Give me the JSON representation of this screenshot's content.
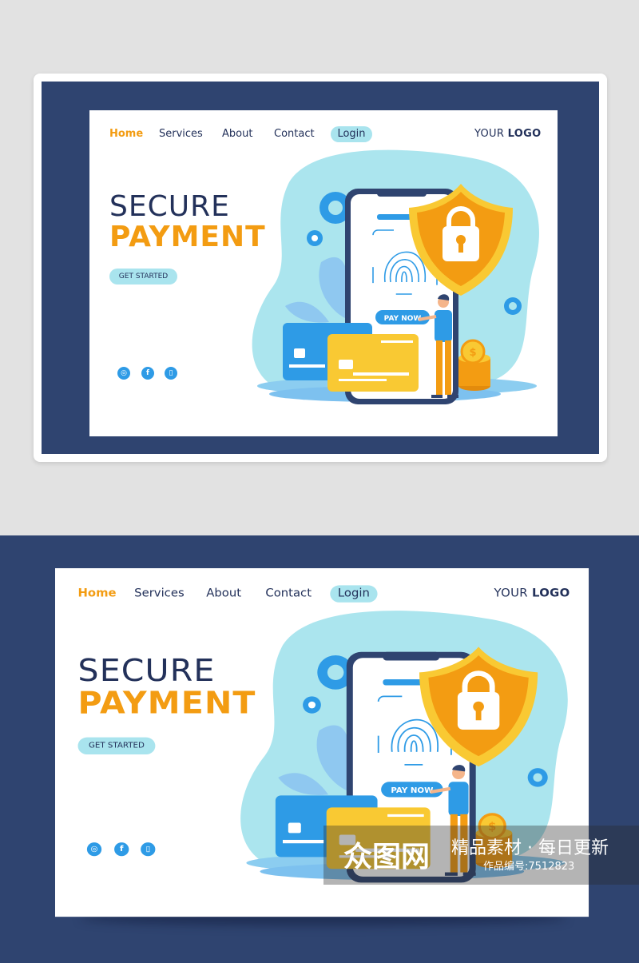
{
  "nav": {
    "items": [
      "Home",
      "Services",
      "About",
      "Contact"
    ],
    "login": "Login",
    "logo_light": "YOUR",
    "logo_bold": "LOGO"
  },
  "hero": {
    "line1": "SECURE",
    "line2": "PAYMENT",
    "cta": "GET STARTED",
    "pay_button": "PAY NOW"
  },
  "social": [
    "instagram-icon",
    "facebook-icon",
    "phone-icon"
  ],
  "watermark": {
    "logo": "众图网",
    "slogan": "精品素材 · 每日更新",
    "id": "作品编号:7512823"
  },
  "colors": {
    "navy": "#2f4470",
    "accent": "#f39c12",
    "light_blue": "#a9e4ee",
    "blue": "#2e9be6",
    "yellow": "#f9c933"
  }
}
